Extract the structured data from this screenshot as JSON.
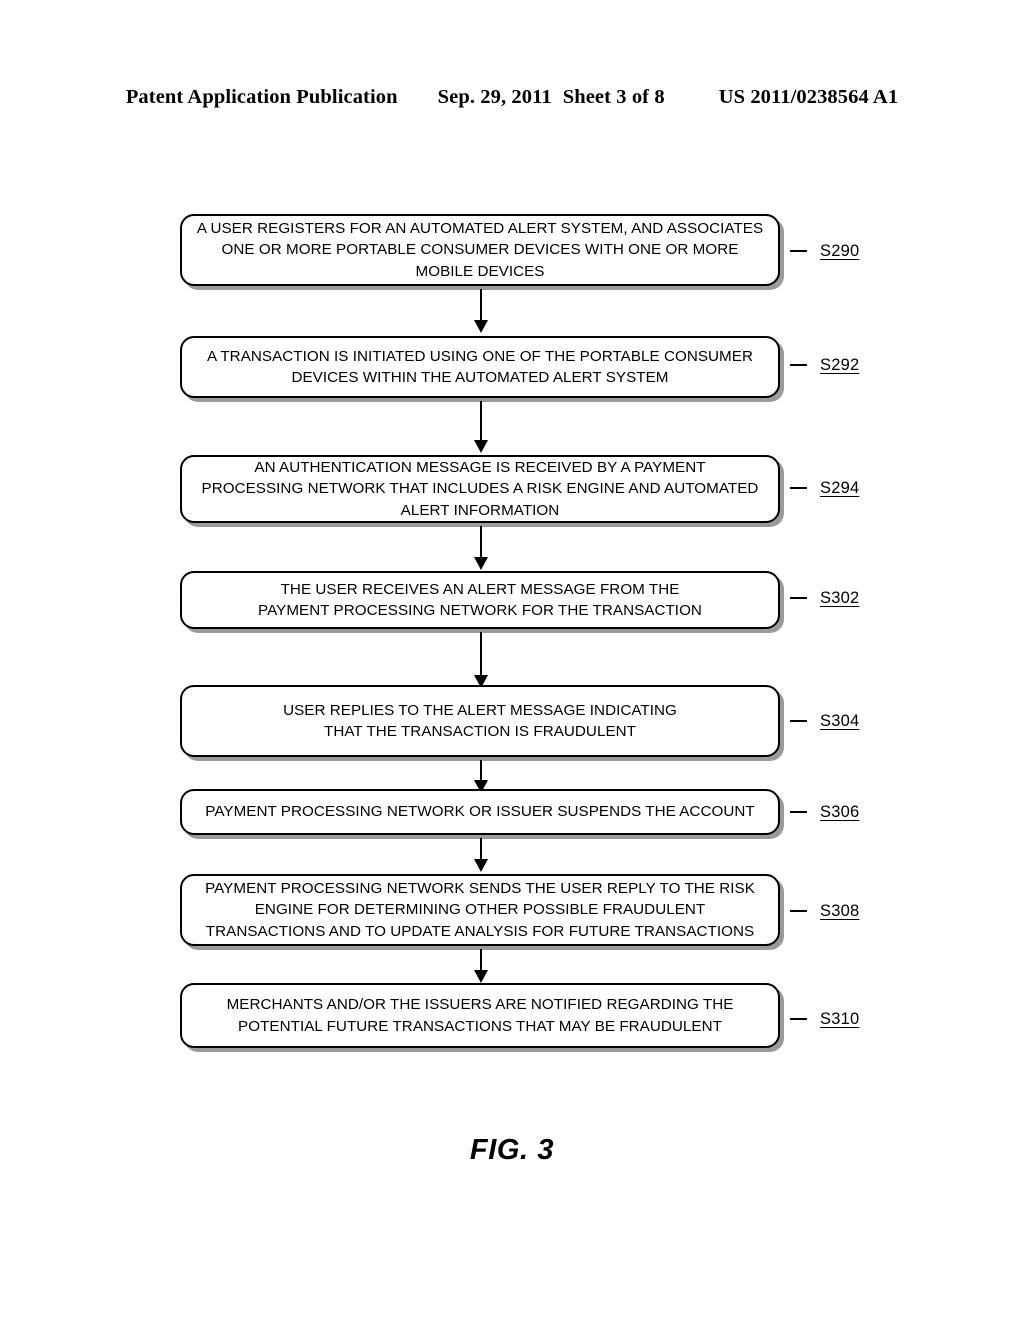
{
  "header": {
    "publication": "Patent Application Publication",
    "date": "Sep. 29, 2011",
    "sheet": "Sheet 3 of 8",
    "document_number": "US 2011/0238564 A1"
  },
  "figure": {
    "caption": "FIG. 3",
    "type": "flowchart",
    "orientation": "vertical",
    "node_count": 8,
    "connector_count": 7
  },
  "flowchart": {
    "nodes": [
      {
        "id": "S290",
        "step_label": "S290",
        "text": "A USER REGISTERS FOR AN AUTOMATED ALERT SYSTEM, AND ASSOCIATES\nONE OR MORE PORTABLE CONSUMER DEVICES WITH ONE OR MORE\nMOBILE DEVICES"
      },
      {
        "id": "S292",
        "step_label": "S292",
        "text": "A TRANSACTION IS INITIATED USING ONE OF THE PORTABLE CONSUMER\nDEVICES WITHIN THE AUTOMATED ALERT SYSTEM"
      },
      {
        "id": "S294",
        "step_label": "S294",
        "text": "AN AUTHENTICATION MESSAGE IS RECEIVED BY A PAYMENT\nPROCESSING NETWORK THAT INCLUDES A RISK ENGINE AND AUTOMATED\nALERT INFORMATION"
      },
      {
        "id": "S302",
        "step_label": "S302",
        "text": "THE USER RECEIVES AN ALERT MESSAGE FROM THE\nPAYMENT PROCESSING NETWORK FOR THE TRANSACTION"
      },
      {
        "id": "S304",
        "step_label": "S304",
        "text": "USER REPLIES TO THE ALERT MESSAGE INDICATING\nTHAT THE TRANSACTION IS FRAUDULENT"
      },
      {
        "id": "S306",
        "step_label": "S306",
        "text": "PAYMENT PROCESSING NETWORK OR ISSUER SUSPENDS THE ACCOUNT"
      },
      {
        "id": "S308",
        "step_label": "S308",
        "text": "PAYMENT PROCESSING NETWORK SENDS THE USER REPLY TO THE RISK\nENGINE FOR DETERMINING OTHER POSSIBLE FRAUDULENT\nTRANSACTIONS AND TO UPDATE ANALYSIS FOR FUTURE TRANSACTIONS"
      },
      {
        "id": "S310",
        "step_label": "S310",
        "text": "MERCHANTS AND/OR THE ISSUERS ARE NOTIFIED REGARDING THE\nPOTENTIAL FUTURE TRANSACTIONS THAT MAY BE FRAUDULENT"
      }
    ]
  },
  "colors": {
    "ink": "#000000",
    "paper": "#ffffff",
    "shadow": "#9a9a9a"
  }
}
